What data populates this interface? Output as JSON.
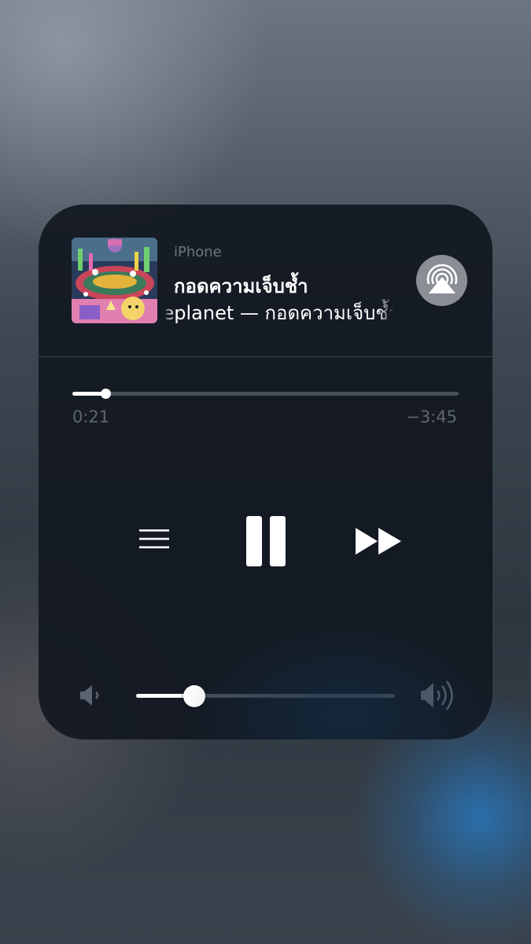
{
  "now_playing": {
    "device": "iPhone",
    "title": "กอดความเจ็บช้ำ",
    "subtitle": "Lifeplanet — กอดความเจ็บช้ำ",
    "elapsed": "0:21",
    "remaining": "−3:45",
    "progress": 0.085
  },
  "controls": {
    "menu_icon": "list-icon",
    "pause_icon": "pause-icon",
    "forward_icon": "fast-forward-icon",
    "airplay_icon": "airplay-icon"
  },
  "volume": {
    "level": 0.225,
    "min_icon": "volume-low-icon",
    "max_icon": "volume-high-icon"
  },
  "colors": {
    "card_background": "#12181f",
    "accent": "#ffffff",
    "secondary_text": "#6c7681",
    "track": "#46505a"
  }
}
